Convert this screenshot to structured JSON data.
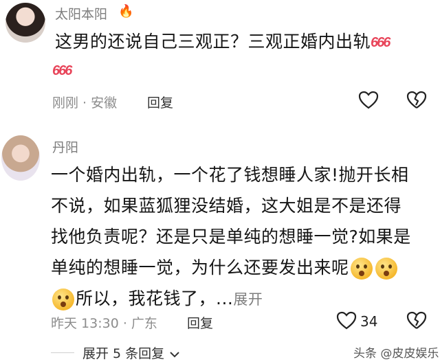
{
  "comments": [
    {
      "username": "太阳本阳",
      "fire": "🔥",
      "line1": "这男的还说自己三观正？三观正婚内出轨",
      "emoji": "666",
      "location": "刚刚 · 安徽",
      "reply_label": "回复"
    },
    {
      "username": "丹阳",
      "lines": [
        "一个婚内出轨，一个花了钱想睡人家!抛开长相",
        "不说，如果蓝狐狸没结婚，这大姐是不是还得",
        "找他负责呢？还是只是单纯的想睡一觉?如果是",
        "单纯的想睡一觉，为什么还要发出来呢"
      ],
      "last_line": "所以，我花钱了，...",
      "expand_label": "展开",
      "location": "昨天 13:30 · 广东",
      "reply_label": "回复",
      "like_count": "34",
      "more_replies": "展开 5 条回复"
    }
  ],
  "watermark": "头条 @皮皮娱乐"
}
